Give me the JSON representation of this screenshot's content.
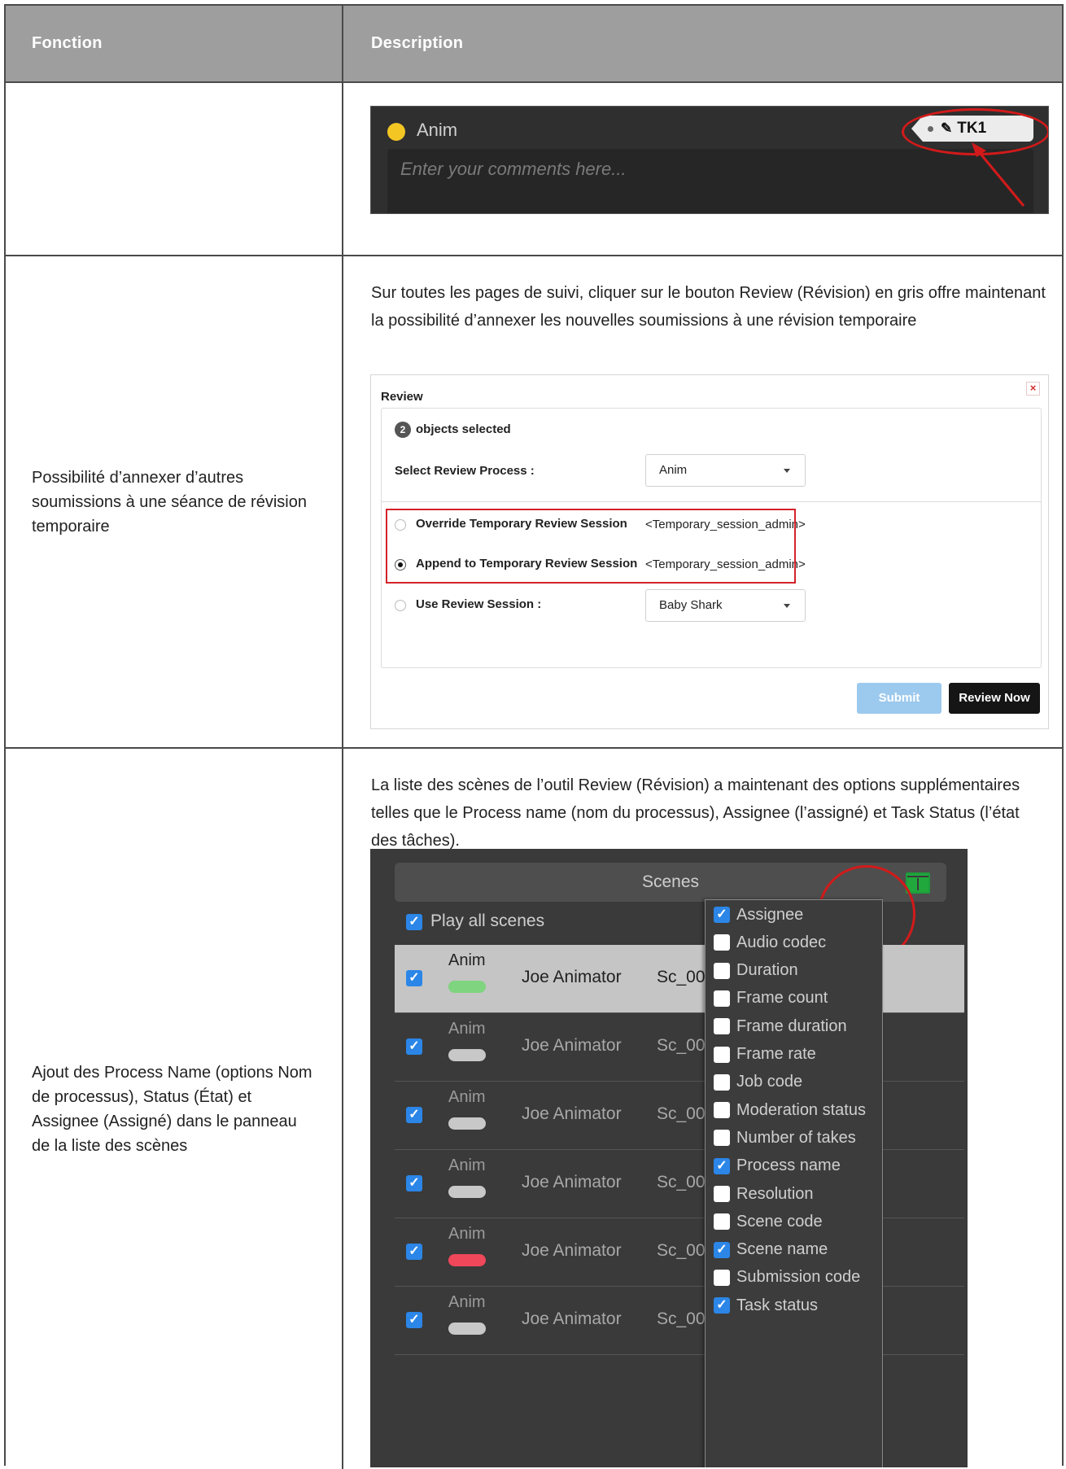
{
  "table": {
    "header": {
      "col1": "Fonction",
      "col2": "Description"
    },
    "row2": {
      "feature": "Possibilité d’annexer d’autres soumissions à une séance de révision temporaire",
      "description": "Sur toutes les pages de suivi, cliquer sur le bouton Review (Révision) en gris offre maintenant la possibilité d’annexer les nouvelles soumissions à une révision temporaire"
    },
    "row3": {
      "feature": "Ajout des Process Name (options Nom de processus), Status (État) et Assignee (Assigné) dans le panneau de la liste des scènes",
      "description": "La liste des scènes de l’outil Review (Révision) a maintenant des options supplémentaires telles que le Process name (nom du processus), Assignee (l’assigné) et Task Status (l’état des tâches)."
    }
  },
  "comment_panel": {
    "process": "Anim",
    "placeholder": "Enter your comments here...",
    "take_tag": "TK1",
    "status_color": "#f3c623"
  },
  "review_dialog": {
    "title": "Review",
    "close_glyph": "×",
    "selected_count": "2",
    "selected_label": "objects selected",
    "process_label": "Select Review Process :",
    "process_value": "Anim",
    "override_label": "Override Temporary Review Session",
    "override_value": "<Temporary_session_admin>",
    "append_label": "Append to Temporary Review Session",
    "append_value": "<Temporary_session_admin>",
    "use_label": "Use Review Session :",
    "use_value": "Baby Shark",
    "submit_label": "Submit",
    "review_now_label": "Review Now"
  },
  "scenes_panel": {
    "title": "Scenes",
    "play_all": "Play all scenes",
    "rows": [
      {
        "process": "Anim",
        "assignee": "Joe Animator",
        "code": "Sc_00",
        "status_color": "#7fd47f",
        "selected": true
      },
      {
        "process": "Anim",
        "assignee": "Joe Animator",
        "code": "Sc_00",
        "status_color": "#c8c8c8",
        "selected": false
      },
      {
        "process": "Anim",
        "assignee": "Joe Animator",
        "code": "Sc_00",
        "status_color": "#c8c8c8",
        "selected": false
      },
      {
        "process": "Anim",
        "assignee": "Joe Animator",
        "code": "Sc_00",
        "status_color": "#c8c8c8",
        "selected": false
      },
      {
        "process": "Anim",
        "assignee": "Joe Animator",
        "code": "Sc_00",
        "status_color": "#f0475a",
        "selected": false
      },
      {
        "process": "Anim",
        "assignee": "Joe Animator",
        "code": "Sc_00",
        "status_color": "#c8c8c8",
        "selected": false
      }
    ],
    "columns_menu": [
      {
        "label": "Assignee",
        "checked": true
      },
      {
        "label": "Audio codec",
        "checked": false
      },
      {
        "label": "Duration",
        "checked": false
      },
      {
        "label": "Frame count",
        "checked": false
      },
      {
        "label": "Frame duration",
        "checked": false
      },
      {
        "label": "Frame rate",
        "checked": false
      },
      {
        "label": "Job code",
        "checked": false
      },
      {
        "label": "Moderation status",
        "checked": false
      },
      {
        "label": "Number of takes",
        "checked": false
      },
      {
        "label": "Process name",
        "checked": true
      },
      {
        "label": "Resolution",
        "checked": false
      },
      {
        "label": "Scene code",
        "checked": false
      },
      {
        "label": "Scene name",
        "checked": true
      },
      {
        "label": "Submission code",
        "checked": false
      },
      {
        "label": "Task status",
        "checked": true
      }
    ]
  }
}
